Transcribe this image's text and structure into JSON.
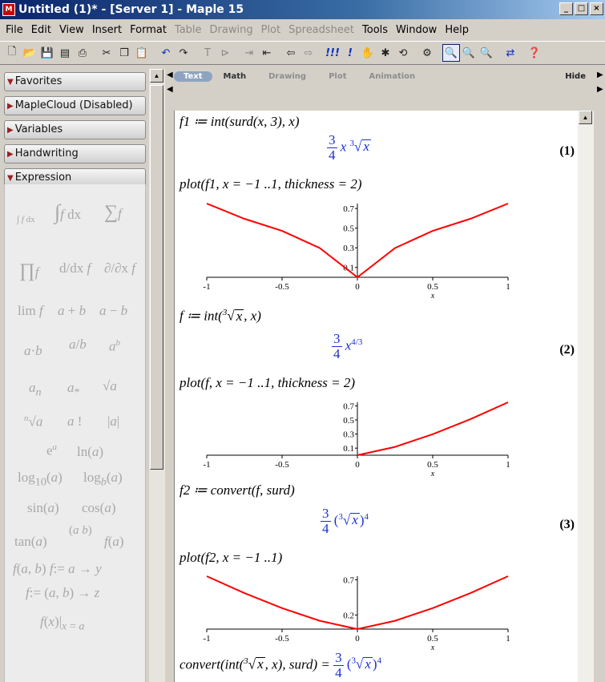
{
  "window": {
    "title": "Untitled (1)* - [Server 1] - Maple 15",
    "app_icon": "M"
  },
  "menu": [
    "File",
    "Edit",
    "View",
    "Insert",
    "Format",
    "Table",
    "Drawing",
    "Plot",
    "Spreadsheet",
    "Tools",
    "Window",
    "Help"
  ],
  "menu_disabled": [
    "Table",
    "Drawing",
    "Plot",
    "Spreadsheet"
  ],
  "palette": {
    "sections": [
      "Favorites",
      "MapleCloud (Disabled)",
      "Variables",
      "Handwriting",
      "Expression"
    ]
  },
  "ribbon": {
    "tabs": [
      "Text",
      "Math",
      "Drawing",
      "Plot",
      "Animation"
    ],
    "hide": "Hide"
  },
  "doc": {
    "in1": "f1 ≔ int(surd(x, 3), x)",
    "out1_num": "3",
    "out1_den": "4",
    "out1_x": "x",
    "out1_idx": "3",
    "out1_rad": "x",
    "eq1": "(1)",
    "in2": "plot(f1, x = −1 ..1, thickness = 2)",
    "in3": "f ≔ int(",
    "in3_tail": ", x)",
    "in3_idx": "3",
    "in3_rad": "x",
    "out3_num": "3",
    "out3_den": "4",
    "out3_x": "x",
    "out3_exp": "4/3",
    "eq2": "(2)",
    "in4": "plot(f, x = −1 ..1, thickness = 2)",
    "in5": "f2 ≔ convert(f, surd)",
    "out5_num": "3",
    "out5_den": "4",
    "out5_idx": "3",
    "out5_rad": "x",
    "out5_exp": "4",
    "eq3": "(3)",
    "in6": "plot(f2, x = −1 ..1)",
    "in7_pre": "convert(int(",
    "in7_mid": ", x), surd) =",
    "in7_idx": "3",
    "in7_rad": "x",
    "in7_num": "3",
    "in7_den": "4",
    "in7_idx2": "3",
    "in7_rad2": "x",
    "in7_exp": "4"
  },
  "chart_data": [
    {
      "type": "line",
      "title": "",
      "xlabel": "x",
      "ylabel": "",
      "x": [
        -1,
        -0.75,
        -0.5,
        -0.25,
        0,
        0.25,
        0.5,
        0.75,
        1
      ],
      "series": [
        {
          "values": [
            0.75,
            0.595,
            0.4725,
            0.2976,
            0,
            0.2976,
            0.4725,
            0.595,
            0.75
          ]
        }
      ],
      "xlim": [
        -1,
        1
      ],
      "ylim": [
        0,
        0.75
      ],
      "xticks": [
        "-1",
        "-0.5",
        "0",
        "0.5",
        "1"
      ],
      "yticks": [
        "0.1",
        "0.3",
        "0.5",
        "0.7"
      ],
      "color": "#ff0000"
    },
    {
      "type": "line",
      "title": "",
      "xlabel": "x",
      "ylabel": "",
      "x": [
        0,
        0.25,
        0.5,
        0.75,
        1
      ],
      "series": [
        {
          "values": [
            0,
            0.118,
            0.2976,
            0.511,
            0.75
          ]
        }
      ],
      "xlim": [
        -1,
        1
      ],
      "ylim": [
        0,
        0.75
      ],
      "xticks": [
        "-1",
        "-0.5",
        "0",
        "0.5",
        "1"
      ],
      "yticks": [
        "0.1",
        "0.3",
        "0.5",
        "0.7"
      ],
      "color": "#ff0000"
    },
    {
      "type": "line",
      "title": "",
      "xlabel": "x",
      "ylabel": "",
      "x": [
        -1,
        -0.75,
        -0.5,
        -0.25,
        0,
        0.25,
        0.5,
        0.75,
        1
      ],
      "series": [
        {
          "values": [
            0.75,
            0.511,
            0.2976,
            0.118,
            0,
            0.118,
            0.2976,
            0.511,
            0.75
          ]
        }
      ],
      "xlim": [
        -1,
        1
      ],
      "ylim": [
        0,
        0.75
      ],
      "xticks": [
        "-1",
        "-0.5",
        "0",
        "0.5",
        "1"
      ],
      "yticks": [
        "0.7",
        "0.2"
      ],
      "color": "#ff0000"
    }
  ]
}
